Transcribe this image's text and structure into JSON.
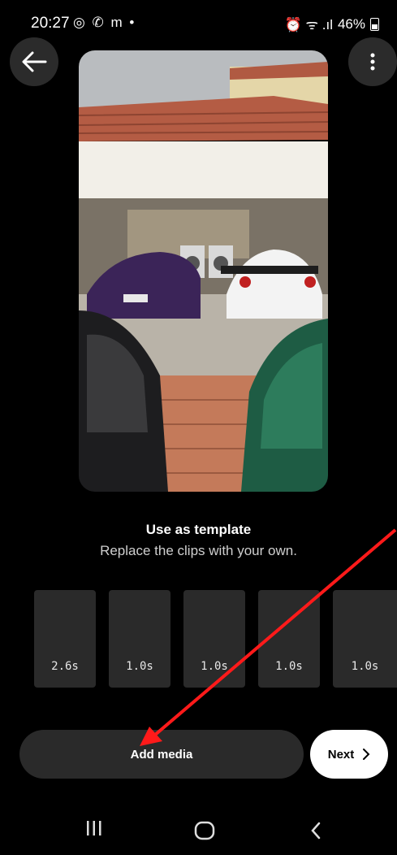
{
  "status_bar": {
    "time": "20:27",
    "apps": "◎ ✆ m •",
    "battery": "46%",
    "signal": "⏰ ᯤ .ıl"
  },
  "header": {
    "back_icon": "arrow-left-icon",
    "more_icon": "more-vertical-icon"
  },
  "template": {
    "title": "Use as template",
    "subtitle": "Replace the clips with your own."
  },
  "clips": [
    {
      "duration": "2.6s"
    },
    {
      "duration": "1.0s"
    },
    {
      "duration": "1.0s"
    },
    {
      "duration": "1.0s"
    },
    {
      "duration": "1.0s"
    }
  ],
  "actions": {
    "add_media": "Add media",
    "next": "Next",
    "next_icon": "chevron-right-icon"
  },
  "nav": {
    "recents_icon": "recents-icon",
    "home_icon": "home-icon",
    "back_icon": "back-chevron-icon"
  },
  "colors": {
    "background": "#000000",
    "surface": "#2a2a2a",
    "annotation_arrow": "#ff1a1a"
  }
}
